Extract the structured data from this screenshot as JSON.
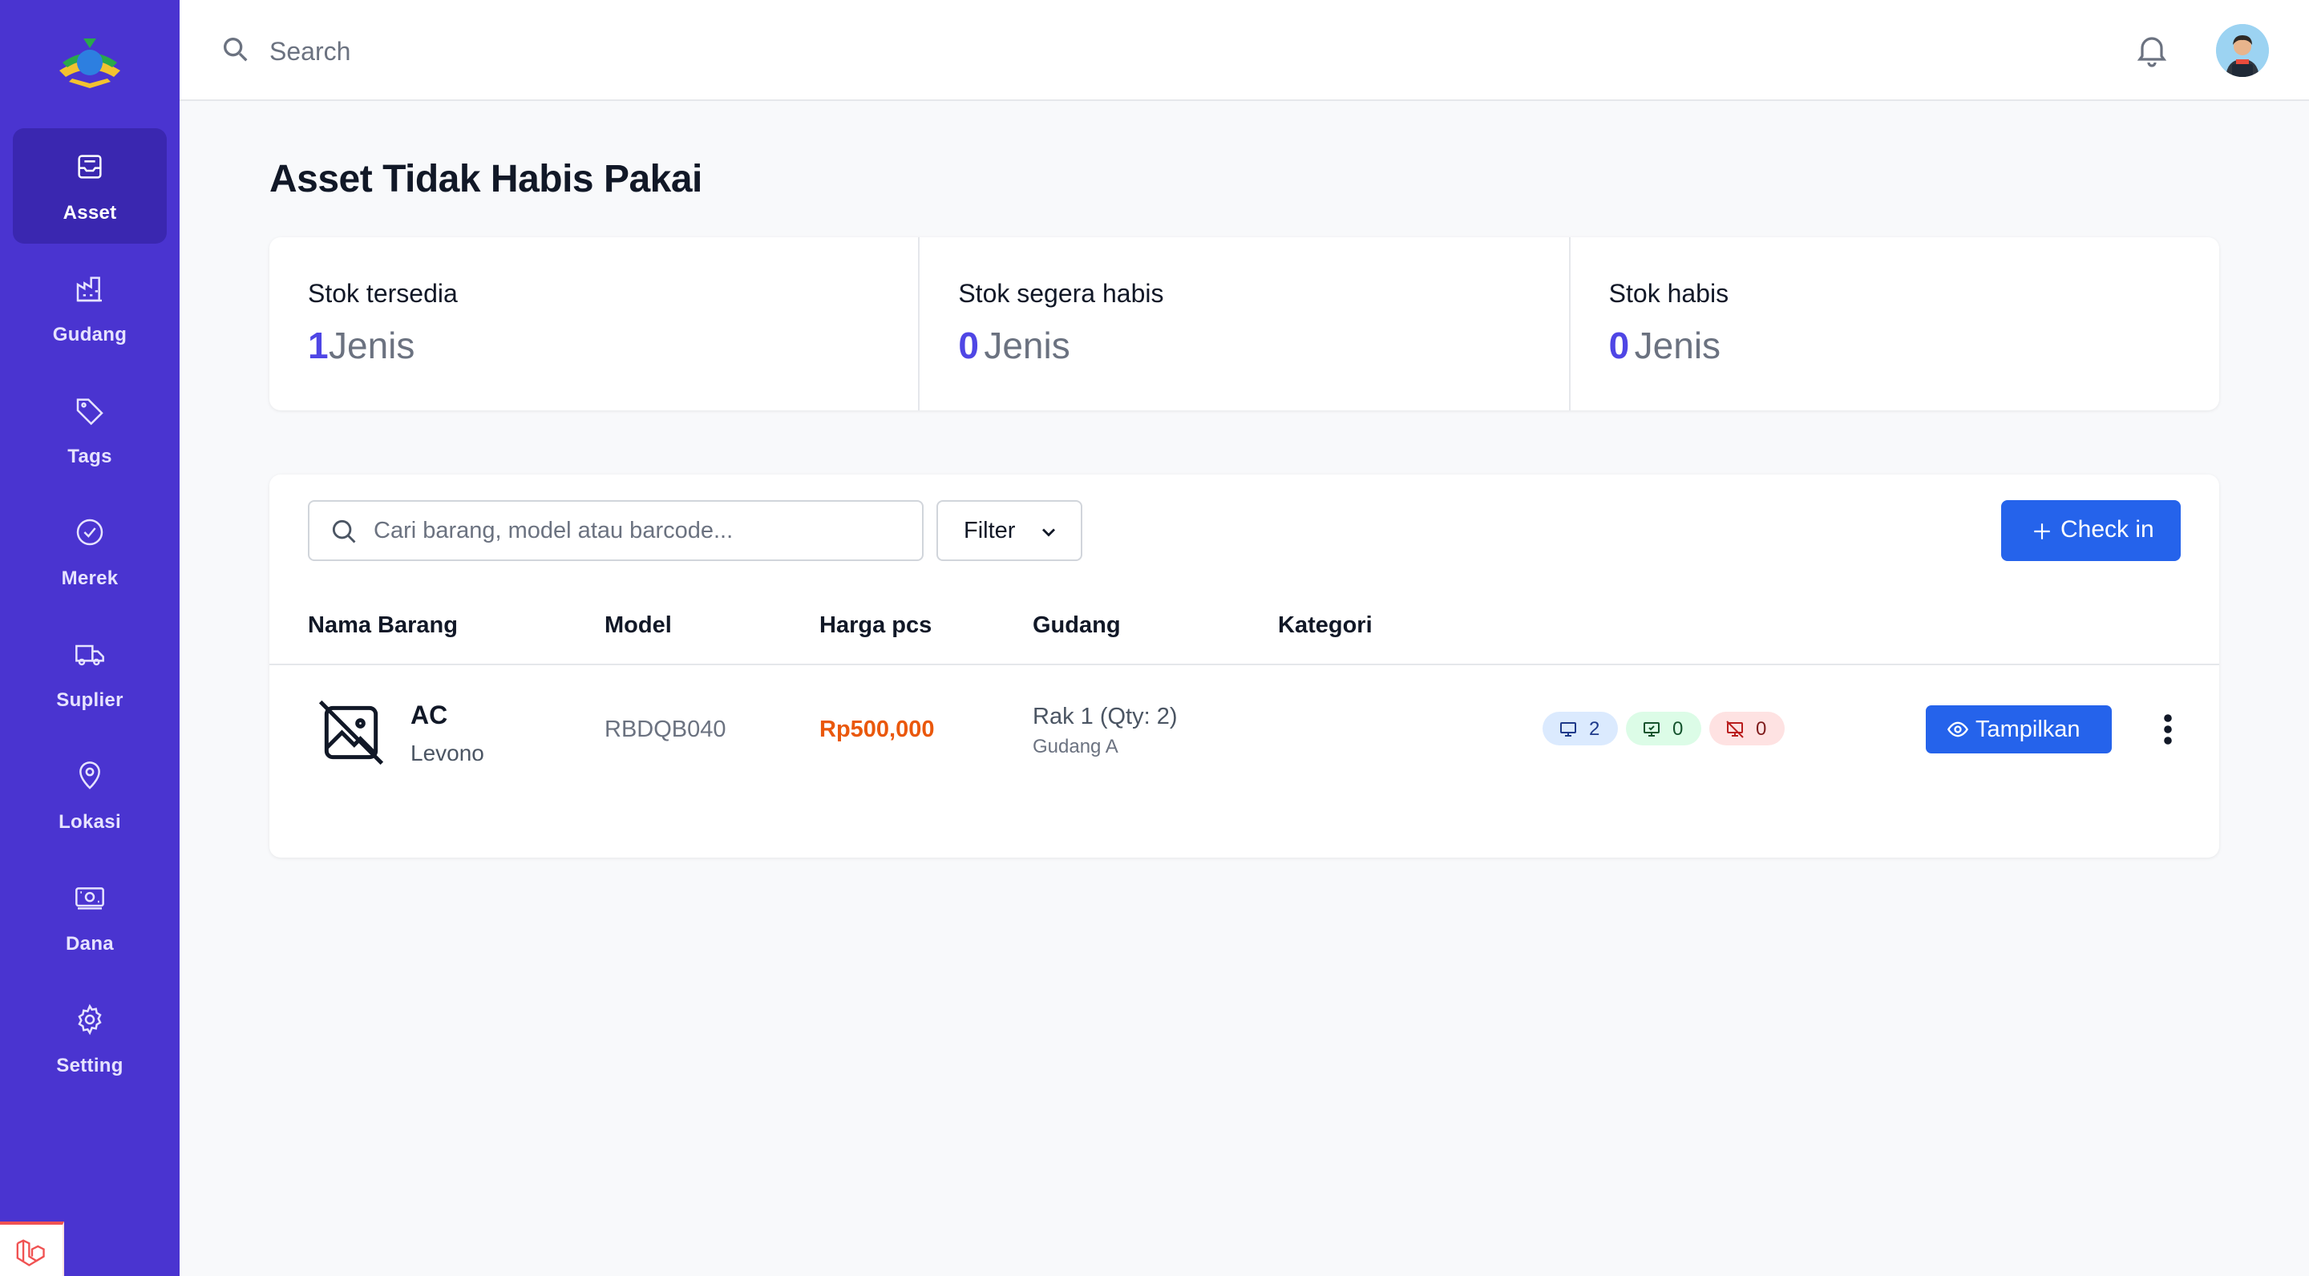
{
  "sidebar": {
    "items": [
      {
        "label": "Asset",
        "icon": "inbox-icon",
        "active": true
      },
      {
        "label": "Gudang",
        "icon": "warehouse-icon"
      },
      {
        "label": "Tags",
        "icon": "tag-icon"
      },
      {
        "label": "Merek",
        "icon": "badge-check-icon"
      },
      {
        "label": "Suplier",
        "icon": "truck-icon"
      },
      {
        "label": "Lokasi",
        "icon": "map-pin-icon"
      },
      {
        "label": "Dana",
        "icon": "banknote-icon"
      },
      {
        "label": "Setting",
        "icon": "gear-icon"
      }
    ],
    "accent": "#4a34d0"
  },
  "topbar": {
    "search_placeholder": "Search"
  },
  "page": {
    "title": "Asset Tidak Habis Pakai"
  },
  "stats": [
    {
      "label": "Stok tersedia",
      "value": "1",
      "unit": "Jenis"
    },
    {
      "label": "Stok segera habis",
      "value": "0",
      "unit": "Jenis"
    },
    {
      "label": "Stok habis",
      "value": "0",
      "unit": "Jenis"
    }
  ],
  "toolbar": {
    "search_placeholder": "Cari barang, model atau barcode...",
    "filter_label": "Filter",
    "checkin_label": "Check in"
  },
  "table": {
    "columns": [
      "Nama Barang",
      "Model",
      "Harga pcs",
      "Gudang",
      "Kategori"
    ],
    "rows": [
      {
        "name": "AC",
        "brand": "Levono",
        "model": "RBDQB040",
        "price": "Rp500,000",
        "rak": "Rak 1 (Qty: 2)",
        "gudang": "Gudang A",
        "kategori": "",
        "badges": {
          "total": "2",
          "available": "0",
          "unavailable": "0"
        },
        "action_label": "Tampilkan"
      }
    ]
  },
  "colors": {
    "primary": "#2563eb",
    "price": "#ea580c",
    "stat_value": "#4f46e5"
  }
}
